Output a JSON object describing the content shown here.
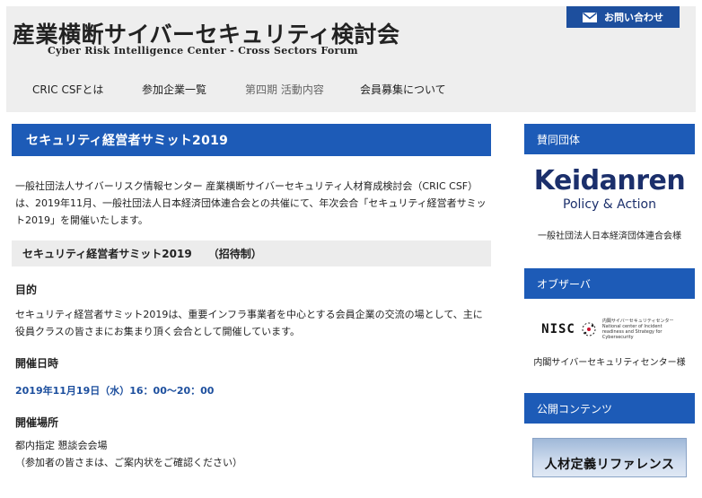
{
  "header": {
    "title": "産業横断サイバーセキュリティ検討会",
    "subtitle": "Cyber Risk Intelligence Center - Cross Sectors Forum",
    "contact_label": "お問い合わせ",
    "nav": [
      {
        "label": "CRIC CSFとは"
      },
      {
        "label": "参加企業一覧"
      },
      {
        "label": "第四期 活動内容"
      },
      {
        "label": "会員募集について"
      }
    ]
  },
  "main": {
    "heading": "セキュリティ経営者サミット2019",
    "intro": "一般社団法人サイバーリスク情報センター 産業横断サイバーセキュリティ人材育成検討会（CRIC CSF）は、2019年11月、一般社団法人日本経済団体連合会との共催にて、年次会合「セキュリティ経営者サミット2019」を開催いたします。",
    "subheading": "セキュリティ経営者サミット2019",
    "subheading_tag": "（招待制）",
    "purpose_label": "目的",
    "purpose_text": "セキュリティ経営者サミット2019は、重要インフラ事業者を中心とする会員企業の交流の場として、主に役員クラスの皆さまにお集まり頂く会合として開催しています。",
    "datetime_label": "開催日時",
    "datetime_value": "2019年11月19日（水）16：00〜20：00",
    "venue_label": "開催場所",
    "venue_line1": "都内指定 懇談会会場",
    "venue_line2": "（参加者の皆さまは、ご案内状をご確認ください）"
  },
  "sidebar": {
    "supporter_head": "賛同団体",
    "keidanren_name": "Keidanren",
    "keidanren_tag": "Policy & Action",
    "keidanren_caption": "一般社団法人日本経済団体連合会様",
    "observer_head": "オブザーバ",
    "nisc_abbr": "NISC",
    "nisc_desc_jp": "内閣サイバーセキュリティセンター",
    "nisc_desc_en": "National center of Incident readiness and Strategy for Cybersecurity",
    "nisc_caption": "内閣サイバーセキュリティセンター様",
    "public_head": "公開コンテンツ",
    "banner_label": "人材定義リファレンス"
  },
  "colors": {
    "brand_blue": "#1d5bb7",
    "dark_blue": "#1d4f9e",
    "keidanren_navy": "#1b2f6b",
    "header_bg": "#eeeeee"
  }
}
